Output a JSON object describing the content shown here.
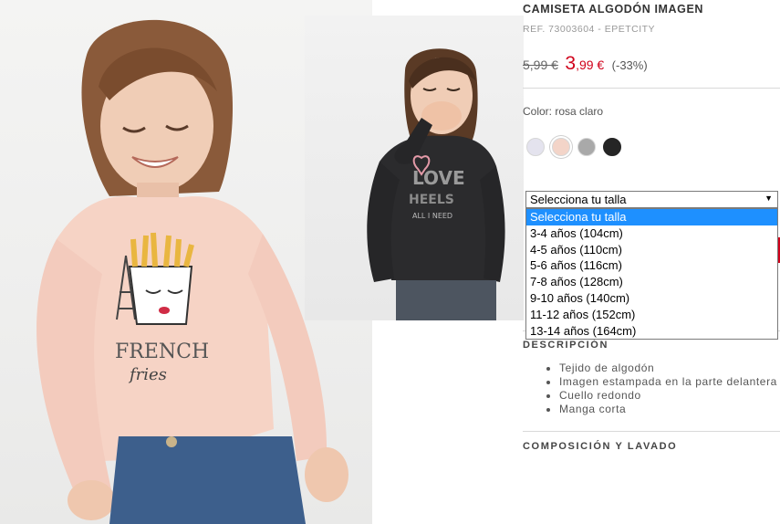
{
  "product": {
    "title": "CAMISETA ALGODÓN IMAGEN",
    "ref": "REF. 73003604 - EPETCITY",
    "price_old": "5,99 €",
    "price_new_int": "3",
    "price_new_rest": ",99 €",
    "discount": "(-33%)"
  },
  "color": {
    "label": "Color: rosa claro",
    "swatches": [
      {
        "name": "lila",
        "hex": "#e4e3ee"
      },
      {
        "name": "rosa claro",
        "hex": "#f3d4c8",
        "selected": true
      },
      {
        "name": "gris",
        "hex": "#a9a9a9"
      },
      {
        "name": "negro",
        "hex": "#252525"
      }
    ]
  },
  "size_select": {
    "value": "Selecciona tu talla",
    "options": [
      "Selecciona tu talla",
      "3-4 años (104cm)",
      "4-5 años (110cm)",
      "5-6 años (116cm)",
      "7-8 años (128cm)",
      "9-10 años (140cm)",
      "11-12 años (152cm)",
      "13-14 años (164cm)"
    ]
  },
  "description": {
    "title": "DESCRIPCIÓN",
    "items": [
      "Tejido de algodón",
      "Imagen estampada en la parte delantera",
      "Cuello redondo",
      "Manga corta"
    ]
  },
  "composition": {
    "title": "COMPOSICIÓN Y LAVADO"
  },
  "images": {
    "main_print_top": "FRENCH",
    "main_print_bottom": "fries",
    "secondary_print_top": "LOVE",
    "secondary_print_mid": "HEELS",
    "secondary_print_bottom": "ALL I NEED"
  },
  "colors": {
    "accent_red": "#d0021b",
    "dropdown_highlight": "#1e90ff"
  }
}
